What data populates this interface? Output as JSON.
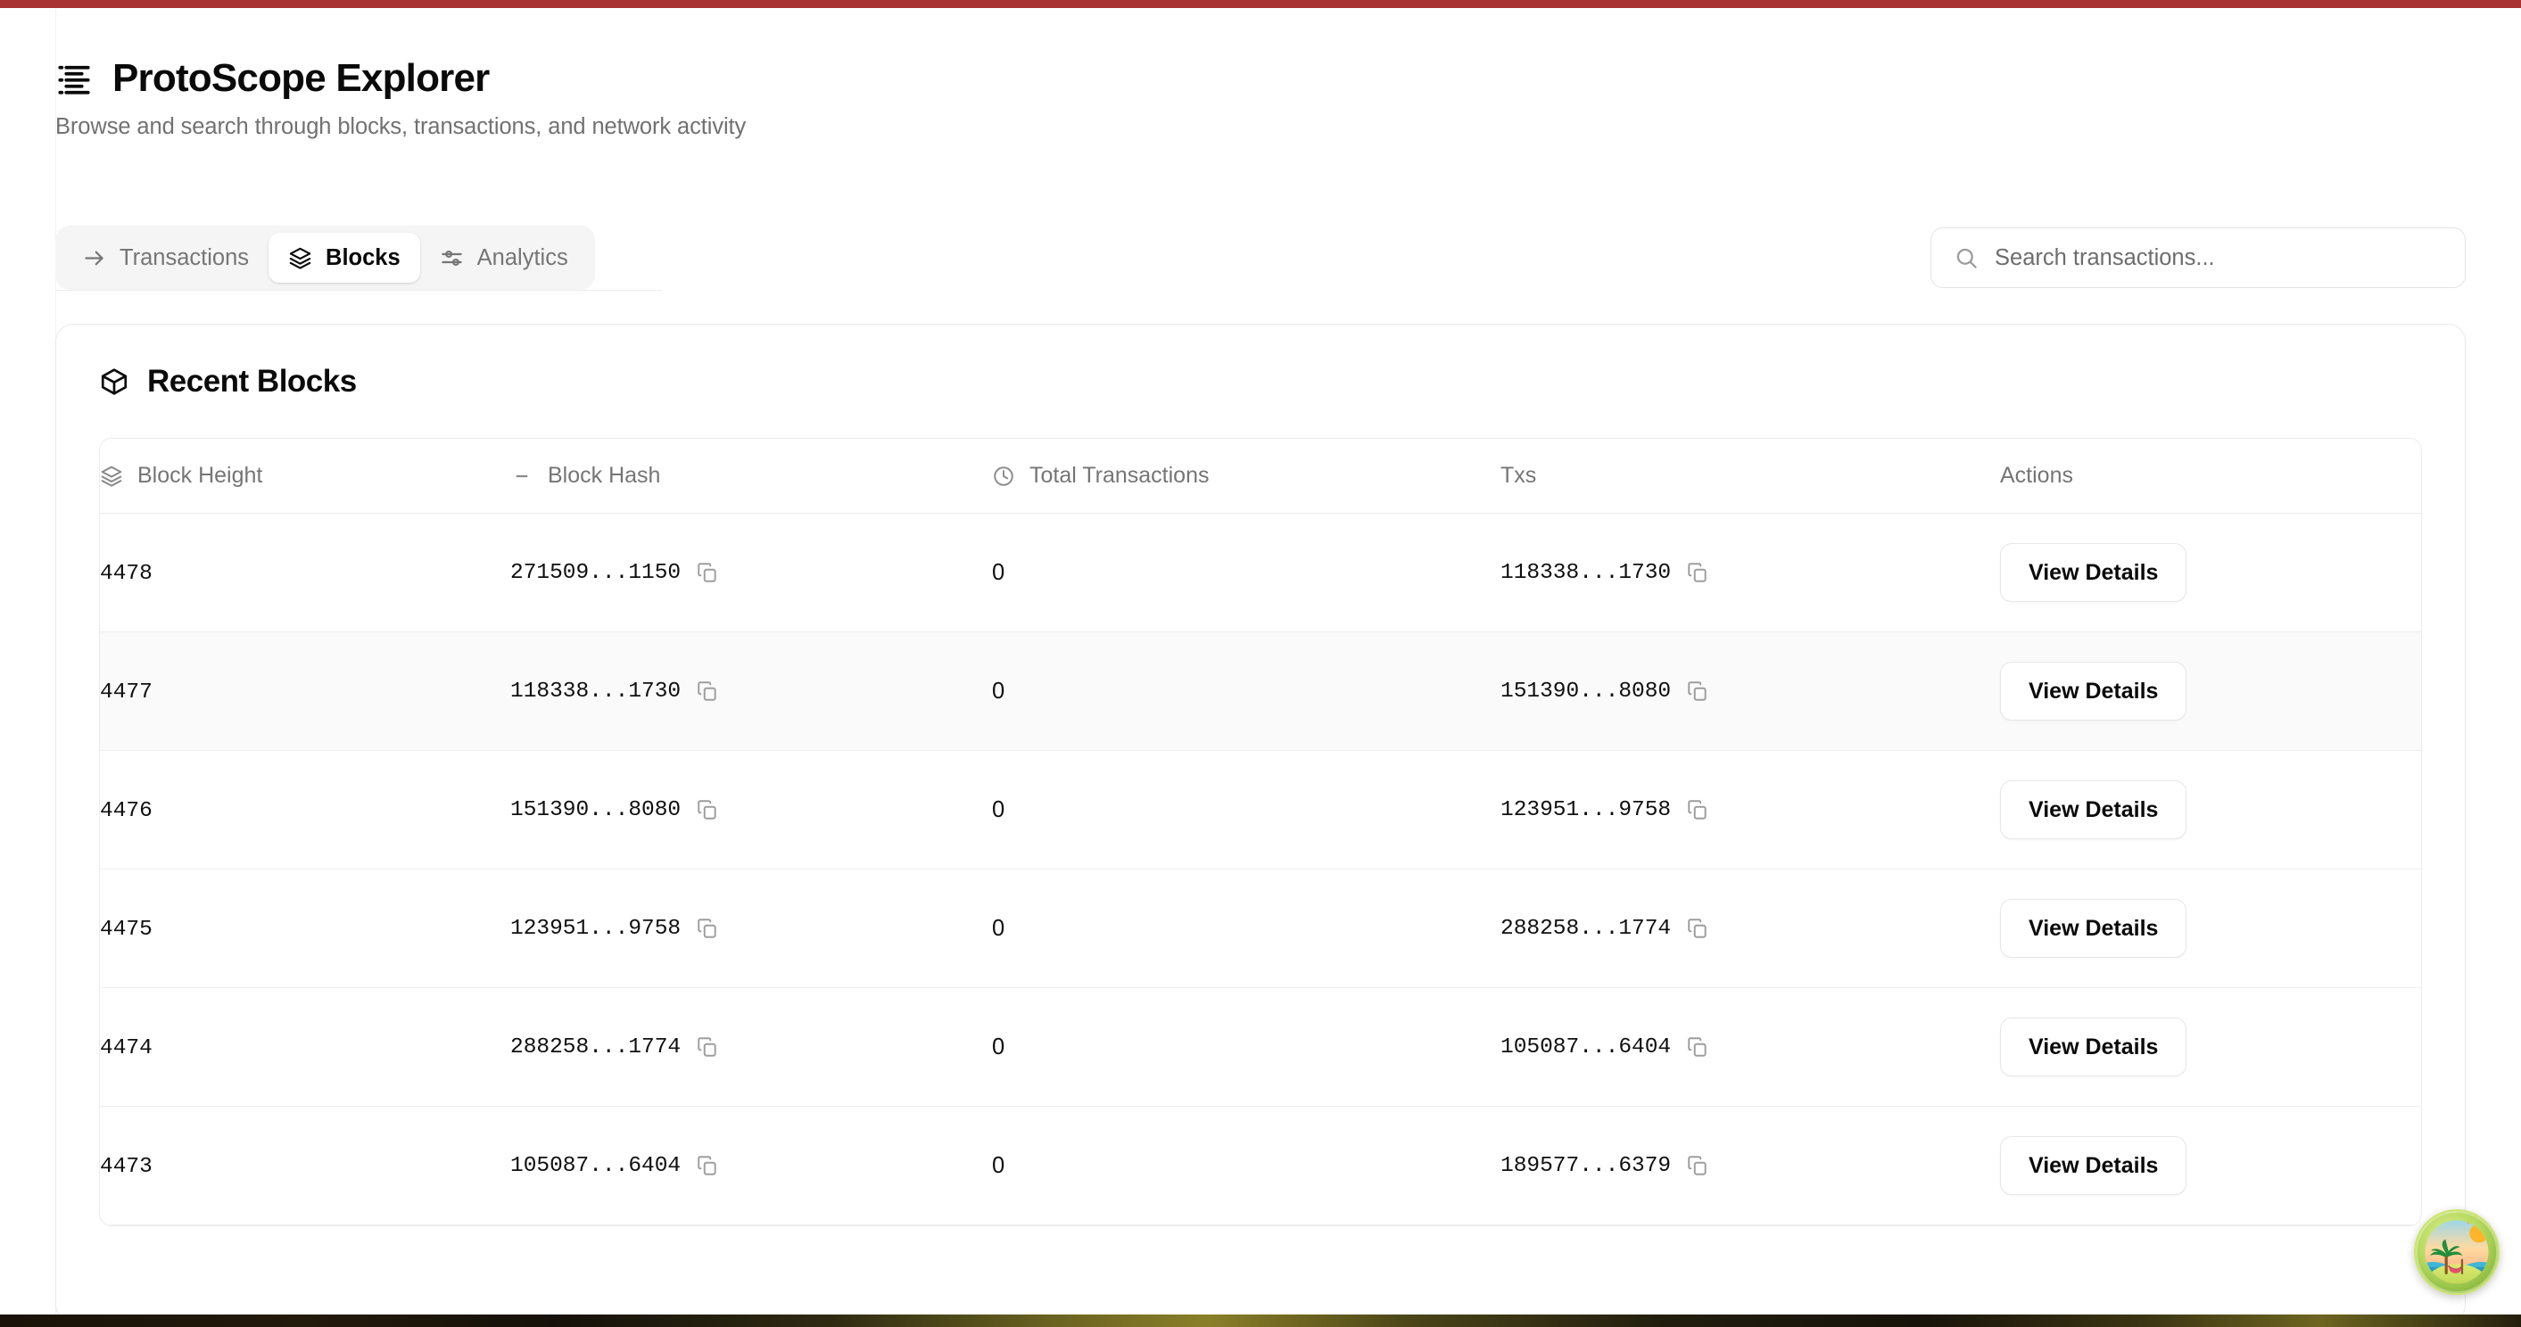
{
  "chrome": {
    "accent_bar_color": "#a83232"
  },
  "header": {
    "icon": "list-lines-icon",
    "title": "ProtoScope Explorer",
    "subtitle": "Browse and search through blocks, transactions, and network activity"
  },
  "tabs": [
    {
      "id": "transactions",
      "label": "Transactions",
      "icon": "arrow-right-icon",
      "active": false
    },
    {
      "id": "blocks",
      "label": "Blocks",
      "icon": "layers-icon",
      "active": true
    },
    {
      "id": "analytics",
      "label": "Analytics",
      "icon": "sliders-icon",
      "active": false
    }
  ],
  "search": {
    "icon": "search-icon",
    "placeholder": "Search transactions...",
    "value": ""
  },
  "card": {
    "icon": "cube-icon",
    "title": "Recent Blocks"
  },
  "table": {
    "columns": [
      {
        "key": "height",
        "label": "Block Height",
        "icon": "layers-icon"
      },
      {
        "key": "hash",
        "label": "Block Hash",
        "icon": "dash-icon"
      },
      {
        "key": "total",
        "label": "Total Transactions",
        "icon": "clock-icon"
      },
      {
        "key": "txs",
        "label": "Txs",
        "icon": null
      },
      {
        "key": "actions",
        "label": "Actions",
        "icon": null
      }
    ],
    "action_label": "View Details",
    "copy_icon": "copy-icon",
    "rows": [
      {
        "height": "4478",
        "hash": "271509...1150",
        "total": "0",
        "txs": "118338...1730",
        "action": "View Details",
        "striped": false
      },
      {
        "height": "4477",
        "hash": "118338...1730",
        "total": "0",
        "txs": "151390...8080",
        "action": "View Details",
        "striped": true
      },
      {
        "height": "4476",
        "hash": "151390...8080",
        "total": "0",
        "txs": "123951...9758",
        "action": "View Details",
        "striped": false
      },
      {
        "height": "4475",
        "hash": "123951...9758",
        "total": "0",
        "txs": "288258...1774",
        "action": "View Details",
        "striped": false
      },
      {
        "height": "4474",
        "hash": "288258...1774",
        "total": "0",
        "txs": "105087...6404",
        "action": "View Details",
        "striped": false
      },
      {
        "height": "4473",
        "hash": "105087...6404",
        "total": "0",
        "txs": "189577...6379",
        "action": "View Details",
        "striped": false
      }
    ]
  },
  "floating_widget": {
    "icon": "tropical-island-icon",
    "label": ""
  }
}
